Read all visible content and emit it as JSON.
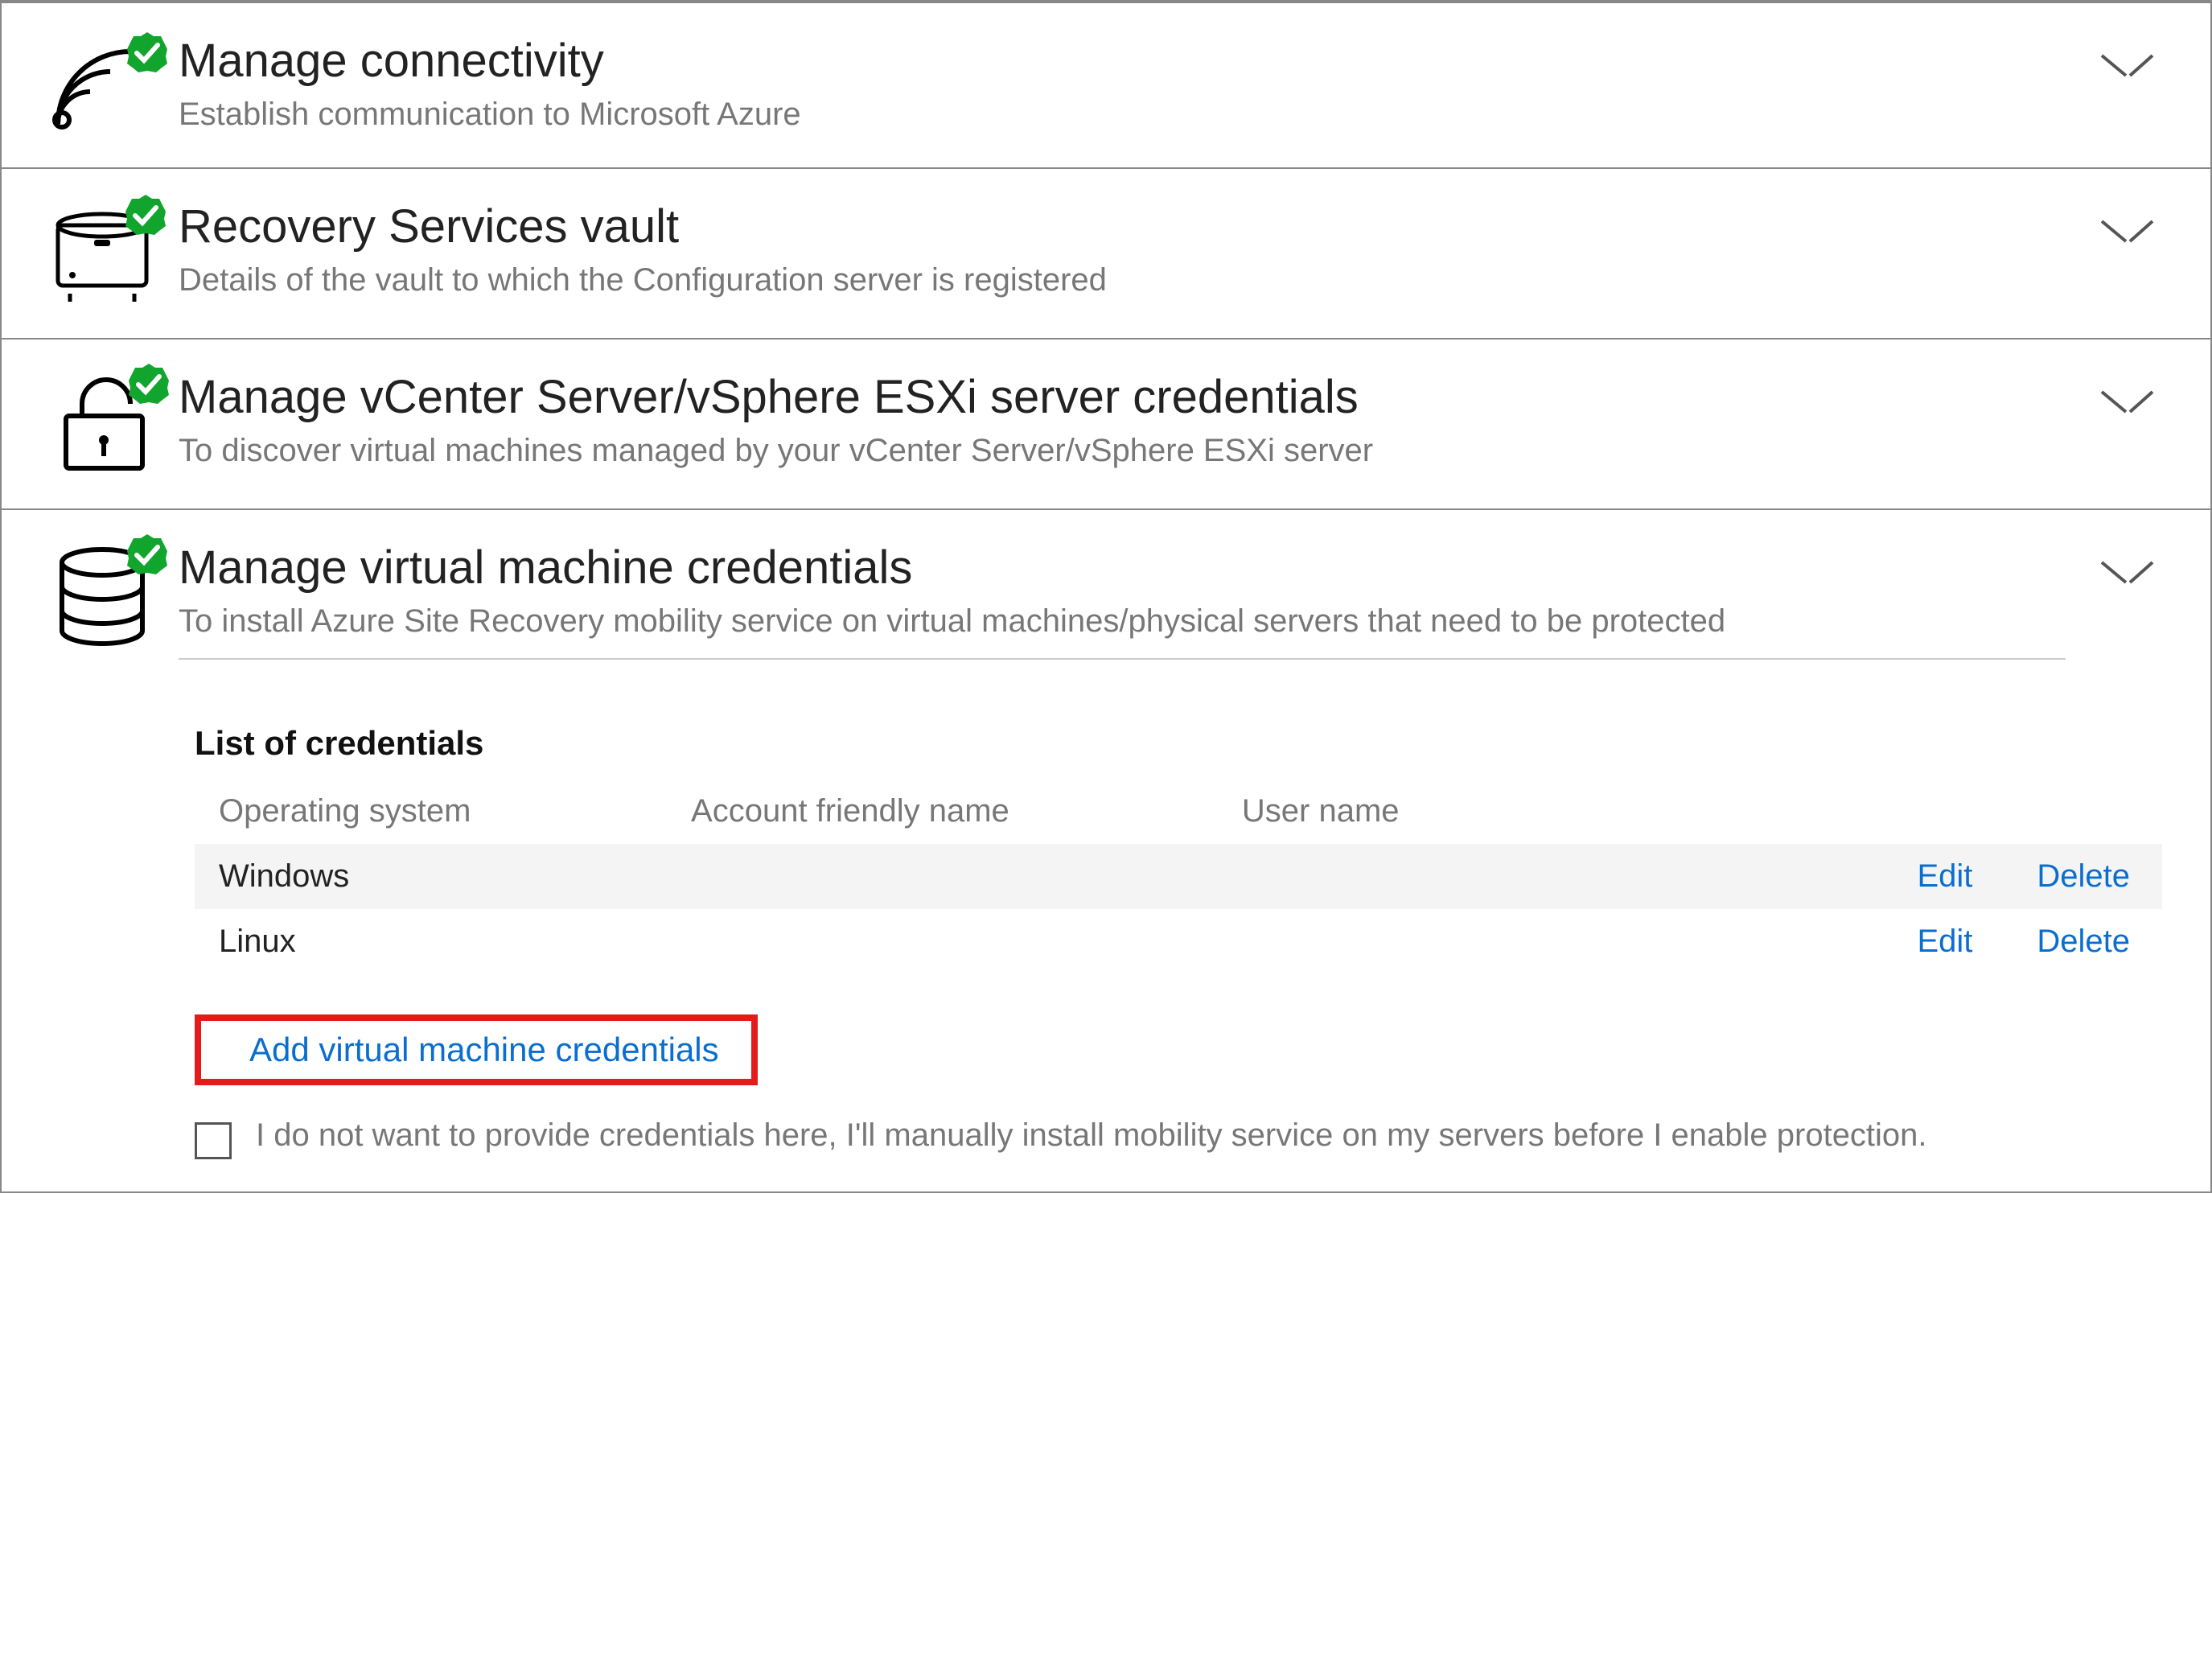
{
  "sections": [
    {
      "title": "Manage connectivity",
      "subtitle": "Establish communication to Microsoft Azure"
    },
    {
      "title": "Recovery Services vault",
      "subtitle": "Details of the vault to which the Configuration server is registered"
    },
    {
      "title": "Manage vCenter Server/vSphere ESXi server credentials",
      "subtitle": "To discover virtual machines managed by your vCenter Server/vSphere ESXi server"
    },
    {
      "title": "Manage virtual machine credentials",
      "subtitle": "To install Azure Site Recovery mobility service on virtual machines/physical servers that need to be protected"
    }
  ],
  "vm_credentials": {
    "list_heading": "List of credentials",
    "columns": {
      "os": "Operating system",
      "friendly": "Account friendly name",
      "user": "User name"
    },
    "rows": [
      {
        "os": "Windows",
        "friendly": "",
        "user": "",
        "edit": "Edit",
        "delete": "Delete"
      },
      {
        "os": "Linux",
        "friendly": "",
        "user": "",
        "edit": "Edit",
        "delete": "Delete"
      }
    ],
    "add_link": "Add virtual machine credentials",
    "opt_out_text": "I do not want to provide credentials here, I'll manually install mobility service on my servers before I enable protection."
  }
}
